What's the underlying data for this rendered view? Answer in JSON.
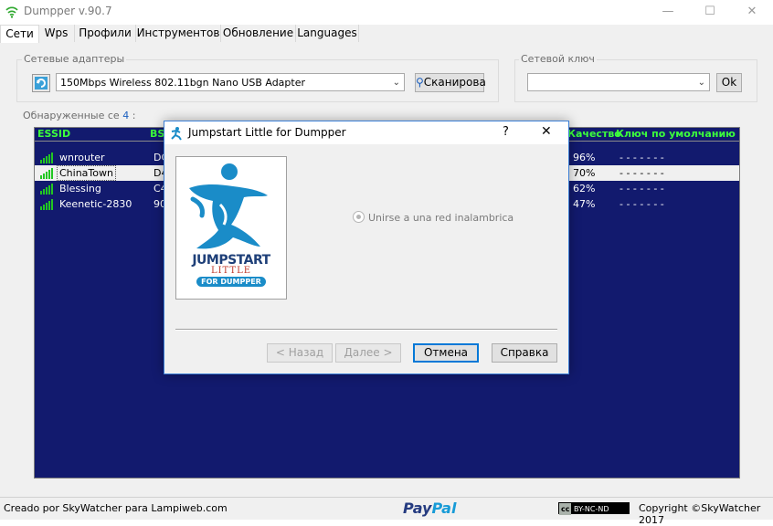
{
  "window": {
    "title": "Dumpper v.90.7",
    "minimize_icon": "minimize-icon",
    "maximize_icon": "maximize-icon",
    "close_icon": "close-icon"
  },
  "tabs": [
    {
      "label": "Сети",
      "active": true
    },
    {
      "label": "Wps",
      "active": false
    },
    {
      "label": "Профили",
      "active": false
    },
    {
      "label": "Инструментов",
      "active": false
    },
    {
      "label": "Обновление",
      "active": false
    },
    {
      "label": "Languages",
      "active": false
    }
  ],
  "adapters": {
    "group_label": "Сетевые адаптеры",
    "selected": "150Mbps Wireless 802.11bgn Nano USB Adapter",
    "scan_label": "Сканирова"
  },
  "netkey": {
    "group_label": "Сетевой ключ",
    "value": "",
    "ok_label": "Ok"
  },
  "discovered": {
    "label": "Обнаруженные се",
    "count": "4",
    "suffix": ":"
  },
  "networks": {
    "columns": [
      "ESSID",
      "BS",
      "Качество",
      "Ключ по умолчанию"
    ],
    "rows": [
      {
        "essid": "wnrouter",
        "bssid": "DC",
        "quality": "96%",
        "key": "- - - - - - -",
        "selected": false
      },
      {
        "essid": "ChinaTown",
        "bssid": "D4",
        "quality": "70%",
        "key": "- - - - - - -",
        "selected": true
      },
      {
        "essid": "Blessing",
        "bssid": "C4",
        "quality": "62%",
        "key": "- - - - - - -",
        "selected": false
      },
      {
        "essid": "Keenetic-2830",
        "bssid": "90",
        "quality": "47%",
        "key": "- - - - - - -",
        "selected": false
      }
    ]
  },
  "dialog": {
    "title": "Jumpstart Little for Dumpper",
    "help": "?",
    "close": "✕",
    "logo": {
      "line1": "JUMPSTART",
      "line2": "LITTLE",
      "line3": "FOR DUMPPER"
    },
    "option": "Unirse a una red inalambrica",
    "back": "< Назад",
    "next": "Далее >",
    "cancel": "Отмена",
    "helpbtn": "Справка"
  },
  "status": {
    "credit": "Creado por SkyWatcher para Lampiweb.com",
    "paypal1": "Pay",
    "paypal2": "Pal",
    "cc": "BY-NC-ND",
    "copyright": "Copyright ©SkyWatcher 2017"
  },
  "colors": {
    "list_bg": "#121a6e",
    "header_text": "#3cff3c",
    "paypal_dark": "#253b80",
    "paypal_light": "#179bd7",
    "jumpstart_blue": "#1a8cc8"
  }
}
